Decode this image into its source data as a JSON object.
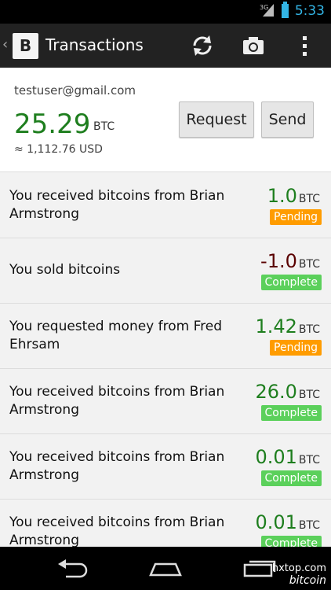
{
  "status": {
    "time": "5:33",
    "network": "3G"
  },
  "actionbar": {
    "title": "Transactions",
    "logo_glyph": "B",
    "icons": [
      "refresh-icon",
      "camera-icon",
      "overflow-menu-icon"
    ]
  },
  "account": {
    "email": "testuser@gmail.com",
    "balance": "25.29",
    "balance_unit": "BTC",
    "usd": "≈ 1,112.76 USD",
    "request_label": "Request",
    "send_label": "Send"
  },
  "transactions": [
    {
      "desc": "You received bitcoins from Brian Armstrong",
      "amount": "1.0",
      "unit": "BTC",
      "status": "Pending"
    },
    {
      "desc": "You sold bitcoins",
      "amount": "-1.0",
      "unit": "BTC",
      "status": "Complete"
    },
    {
      "desc": "You requested money from Fred Ehrsam",
      "amount": "1.42",
      "unit": "BTC",
      "status": "Pending"
    },
    {
      "desc": "You received bitcoins from Brian Armstrong",
      "amount": "26.0",
      "unit": "BTC",
      "status": "Complete"
    },
    {
      "desc": "You received bitcoins from Brian Armstrong",
      "amount": "0.01",
      "unit": "BTC",
      "status": "Complete"
    },
    {
      "desc": "You received bitcoins from Brian Armstrong",
      "amount": "0.01",
      "unit": "BTC",
      "status": "Complete"
    }
  ],
  "colors": {
    "positive": "#1e7e1e",
    "negative": "#5a0000",
    "pending": "#ff9c00",
    "complete": "#5bd05b",
    "accent": "#33b5e5"
  },
  "watermark": {
    "line1": "hxtop.com",
    "line2": "bitcoin"
  }
}
